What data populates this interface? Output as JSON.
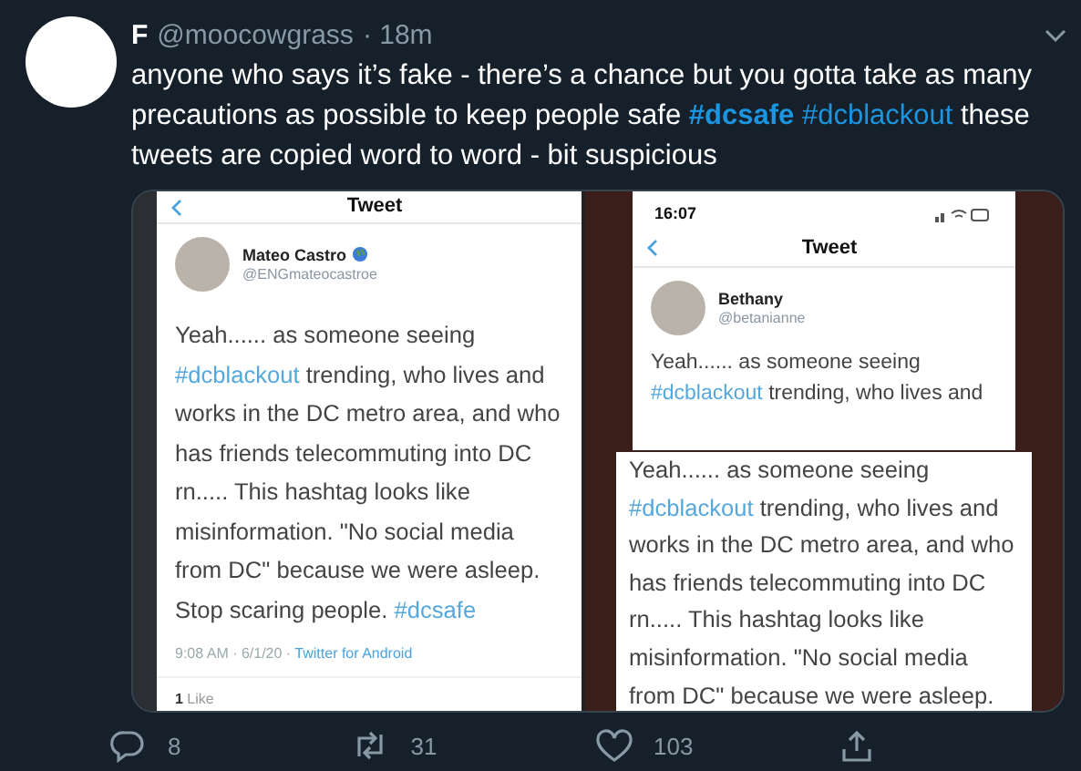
{
  "tweet": {
    "name": "F",
    "handle": "@moocowgrass",
    "time": "· 18m",
    "lines": [
      [
        {
          "kind": "text",
          "text": "anyone who says it’s fake - there’s a chance but you gotta take as many"
        }
      ],
      [
        {
          "kind": "text",
          "text": "precautions as possible to keep people safe "
        },
        {
          "kind": "hashtag",
          "text": "**#dcsafe** "
        },
        {
          "kind": "hashtag",
          "text": "#dcblackout"
        },
        {
          "kind": "text",
          "text": " these"
        }
      ],
      [
        {
          "kind": "text",
          "text": "tweets are copied word to word - bit suspicious"
        }
      ]
    ],
    "actions": [
      {
        "kind": "reply",
        "count": "8"
      },
      {
        "kind": "retweet",
        "count": "31"
      },
      {
        "kind": "like",
        "count": "103"
      },
      {
        "kind": "share"
      }
    ]
  },
  "left_screenshot": {
    "header": "Tweet",
    "name": "Mateo Castro",
    "handle": "@ENGmateocastroe",
    "lines": [
      [
        {
          "kind": "text",
          "text": "Yeah...... as someone seeing"
        }
      ],
      [
        {
          "kind": "hashtag",
          "text": "#dcblackout"
        },
        {
          "kind": "text",
          "text": " trending, who lives and"
        }
      ],
      [
        {
          "kind": "text",
          "text": "works in the DC metro area, and who"
        }
      ],
      [
        {
          "kind": "text",
          "text": "has friends telecommuting into DC"
        }
      ],
      [
        {
          "kind": "text",
          "text": "rn..... This hashtag looks like"
        }
      ],
      [
        {
          "kind": "text",
          "text": "misinformation. \"No social media"
        }
      ],
      [
        {
          "kind": "text",
          "text": "from DC\" because we were asleep."
        }
      ],
      [
        {
          "kind": "text",
          "text": "Stop scaring people. "
        },
        {
          "kind": "hashtag",
          "text": "#dcsafe"
        }
      ]
    ],
    "meta": "9:08 AM · 6/1/20 · ",
    "source": "Twitter for Android",
    "likes_count": "1",
    "likes_label": "Like"
  },
  "right_screenshot": {
    "clock": "16:07",
    "header": "Tweet",
    "name": "Bethany",
    "handle": "@betanianne",
    "lines": [
      [
        {
          "kind": "text",
          "text": "Yeah...... as someone seeing"
        }
      ],
      [
        {
          "kind": "hashtag",
          "text": "#dcblackout"
        },
        {
          "kind": "text",
          "text": " trending, who lives and"
        }
      ]
    ],
    "crop_lines": [
      [
        {
          "kind": "text",
          "text": "Yeah...... as someone seeing"
        }
      ],
      [
        {
          "kind": "hashtag",
          "text": "#dcblackout"
        },
        {
          "kind": "text",
          "text": " trending, who lives and"
        }
      ],
      [
        {
          "kind": "text",
          "text": "works in the DC metro area, and who"
        }
      ],
      [
        {
          "kind": "text",
          "text": "has friends telecommuting into DC"
        }
      ],
      [
        {
          "kind": "text",
          "text": "rn..... This hashtag looks like"
        }
      ],
      [
        {
          "kind": "text",
          "text": "misinformation. \"No social media"
        }
      ],
      [
        {
          "kind": "text",
          "text": "from DC\" because we were asleep."
        }
      ]
    ]
  }
}
